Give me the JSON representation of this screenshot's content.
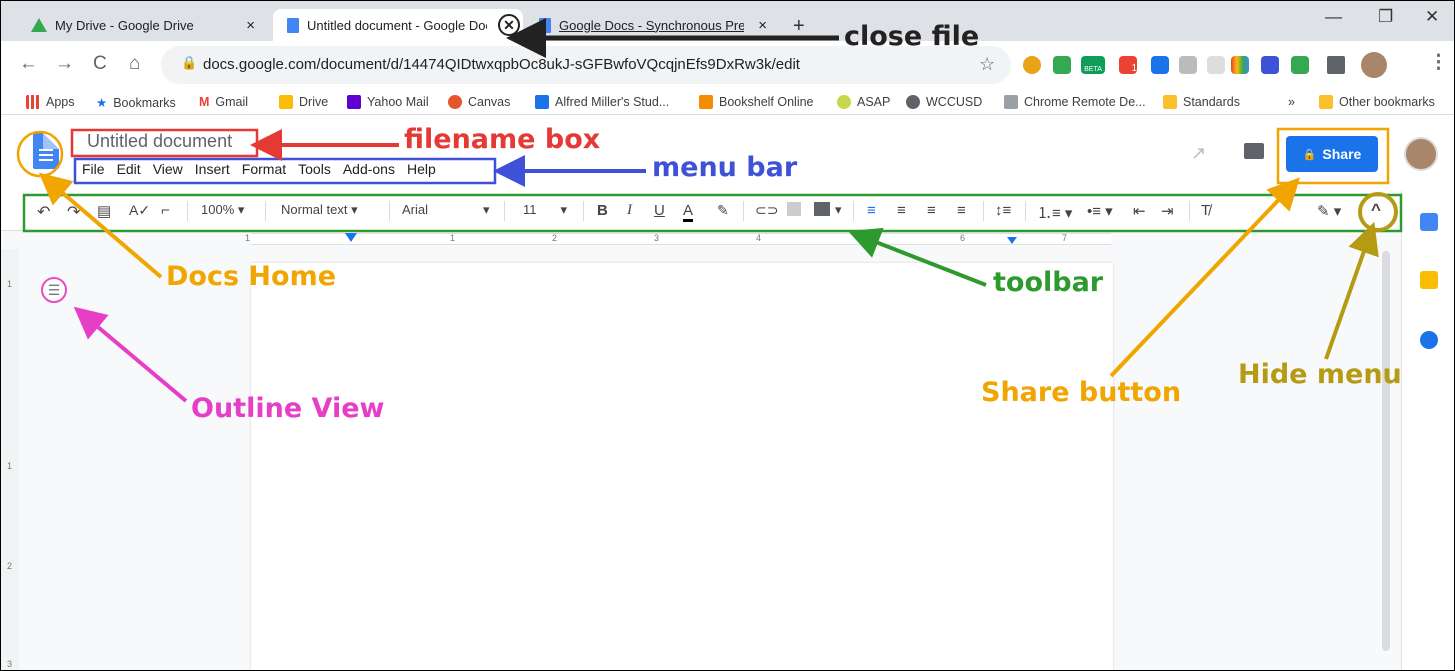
{
  "browser": {
    "tabs": [
      {
        "title": "My Drive - Google Drive",
        "close": "×"
      },
      {
        "title": "Untitled document - Google Doc",
        "close": "×"
      },
      {
        "title": "Google Docs - Synchronous Pres",
        "close": "×"
      }
    ],
    "new_tab": "+",
    "window": {
      "minimize": "—",
      "restore": "❐",
      "close": "✕"
    },
    "url": "docs.google.com/document/d/14474QIDtwxqpbOc8ukJ-sGFBwfoVQcqjnEfs9DxRw3k/edit",
    "ext_badge": "BETA",
    "ext_count": "1",
    "bookmarks": [
      "Apps",
      "Bookmarks",
      "Gmail",
      "Drive",
      "Yahoo Mail",
      "Canvas",
      "Alfred Miller's Stud...",
      "Bookshelf Online",
      "ASAP",
      "WCCUSD",
      "Chrome Remote De...",
      "Standards"
    ],
    "bookmarks_more": "»",
    "other_bookmarks": "Other bookmarks"
  },
  "doc": {
    "filename": "Untitled document",
    "menu": [
      "File",
      "Edit",
      "View",
      "Insert",
      "Format",
      "Tools",
      "Add-ons",
      "Help"
    ],
    "share_label": "Share",
    "share_lock": "🔒"
  },
  "toolbar": {
    "zoom": "100%",
    "style": "Normal text",
    "font": "Arial",
    "size": "11",
    "bold": "B",
    "italic": "I",
    "underline": "U",
    "text_color": "A",
    "collapse": "^"
  },
  "ruler_numbers": [
    "1",
    "1",
    "2",
    "3",
    "4",
    "5",
    "6",
    "7"
  ],
  "vruler_numbers": [
    "1",
    "1",
    "2",
    "3"
  ],
  "annotations": {
    "close_file": "close file",
    "filename_box": "filename box",
    "menu_bar": "menu bar",
    "docs_home": "Docs Home",
    "toolbar": "toolbar",
    "outline_view": "Outline View",
    "share_button": "Share button",
    "hide_menu": "Hide menu"
  },
  "colors": {
    "red": "#e53935",
    "blue": "#3f51d6",
    "orange": "#f0a500",
    "green": "#2e9a2e",
    "magenta": "#e63ec6",
    "olive": "#b59b14",
    "share_blue": "#1a73e8"
  }
}
